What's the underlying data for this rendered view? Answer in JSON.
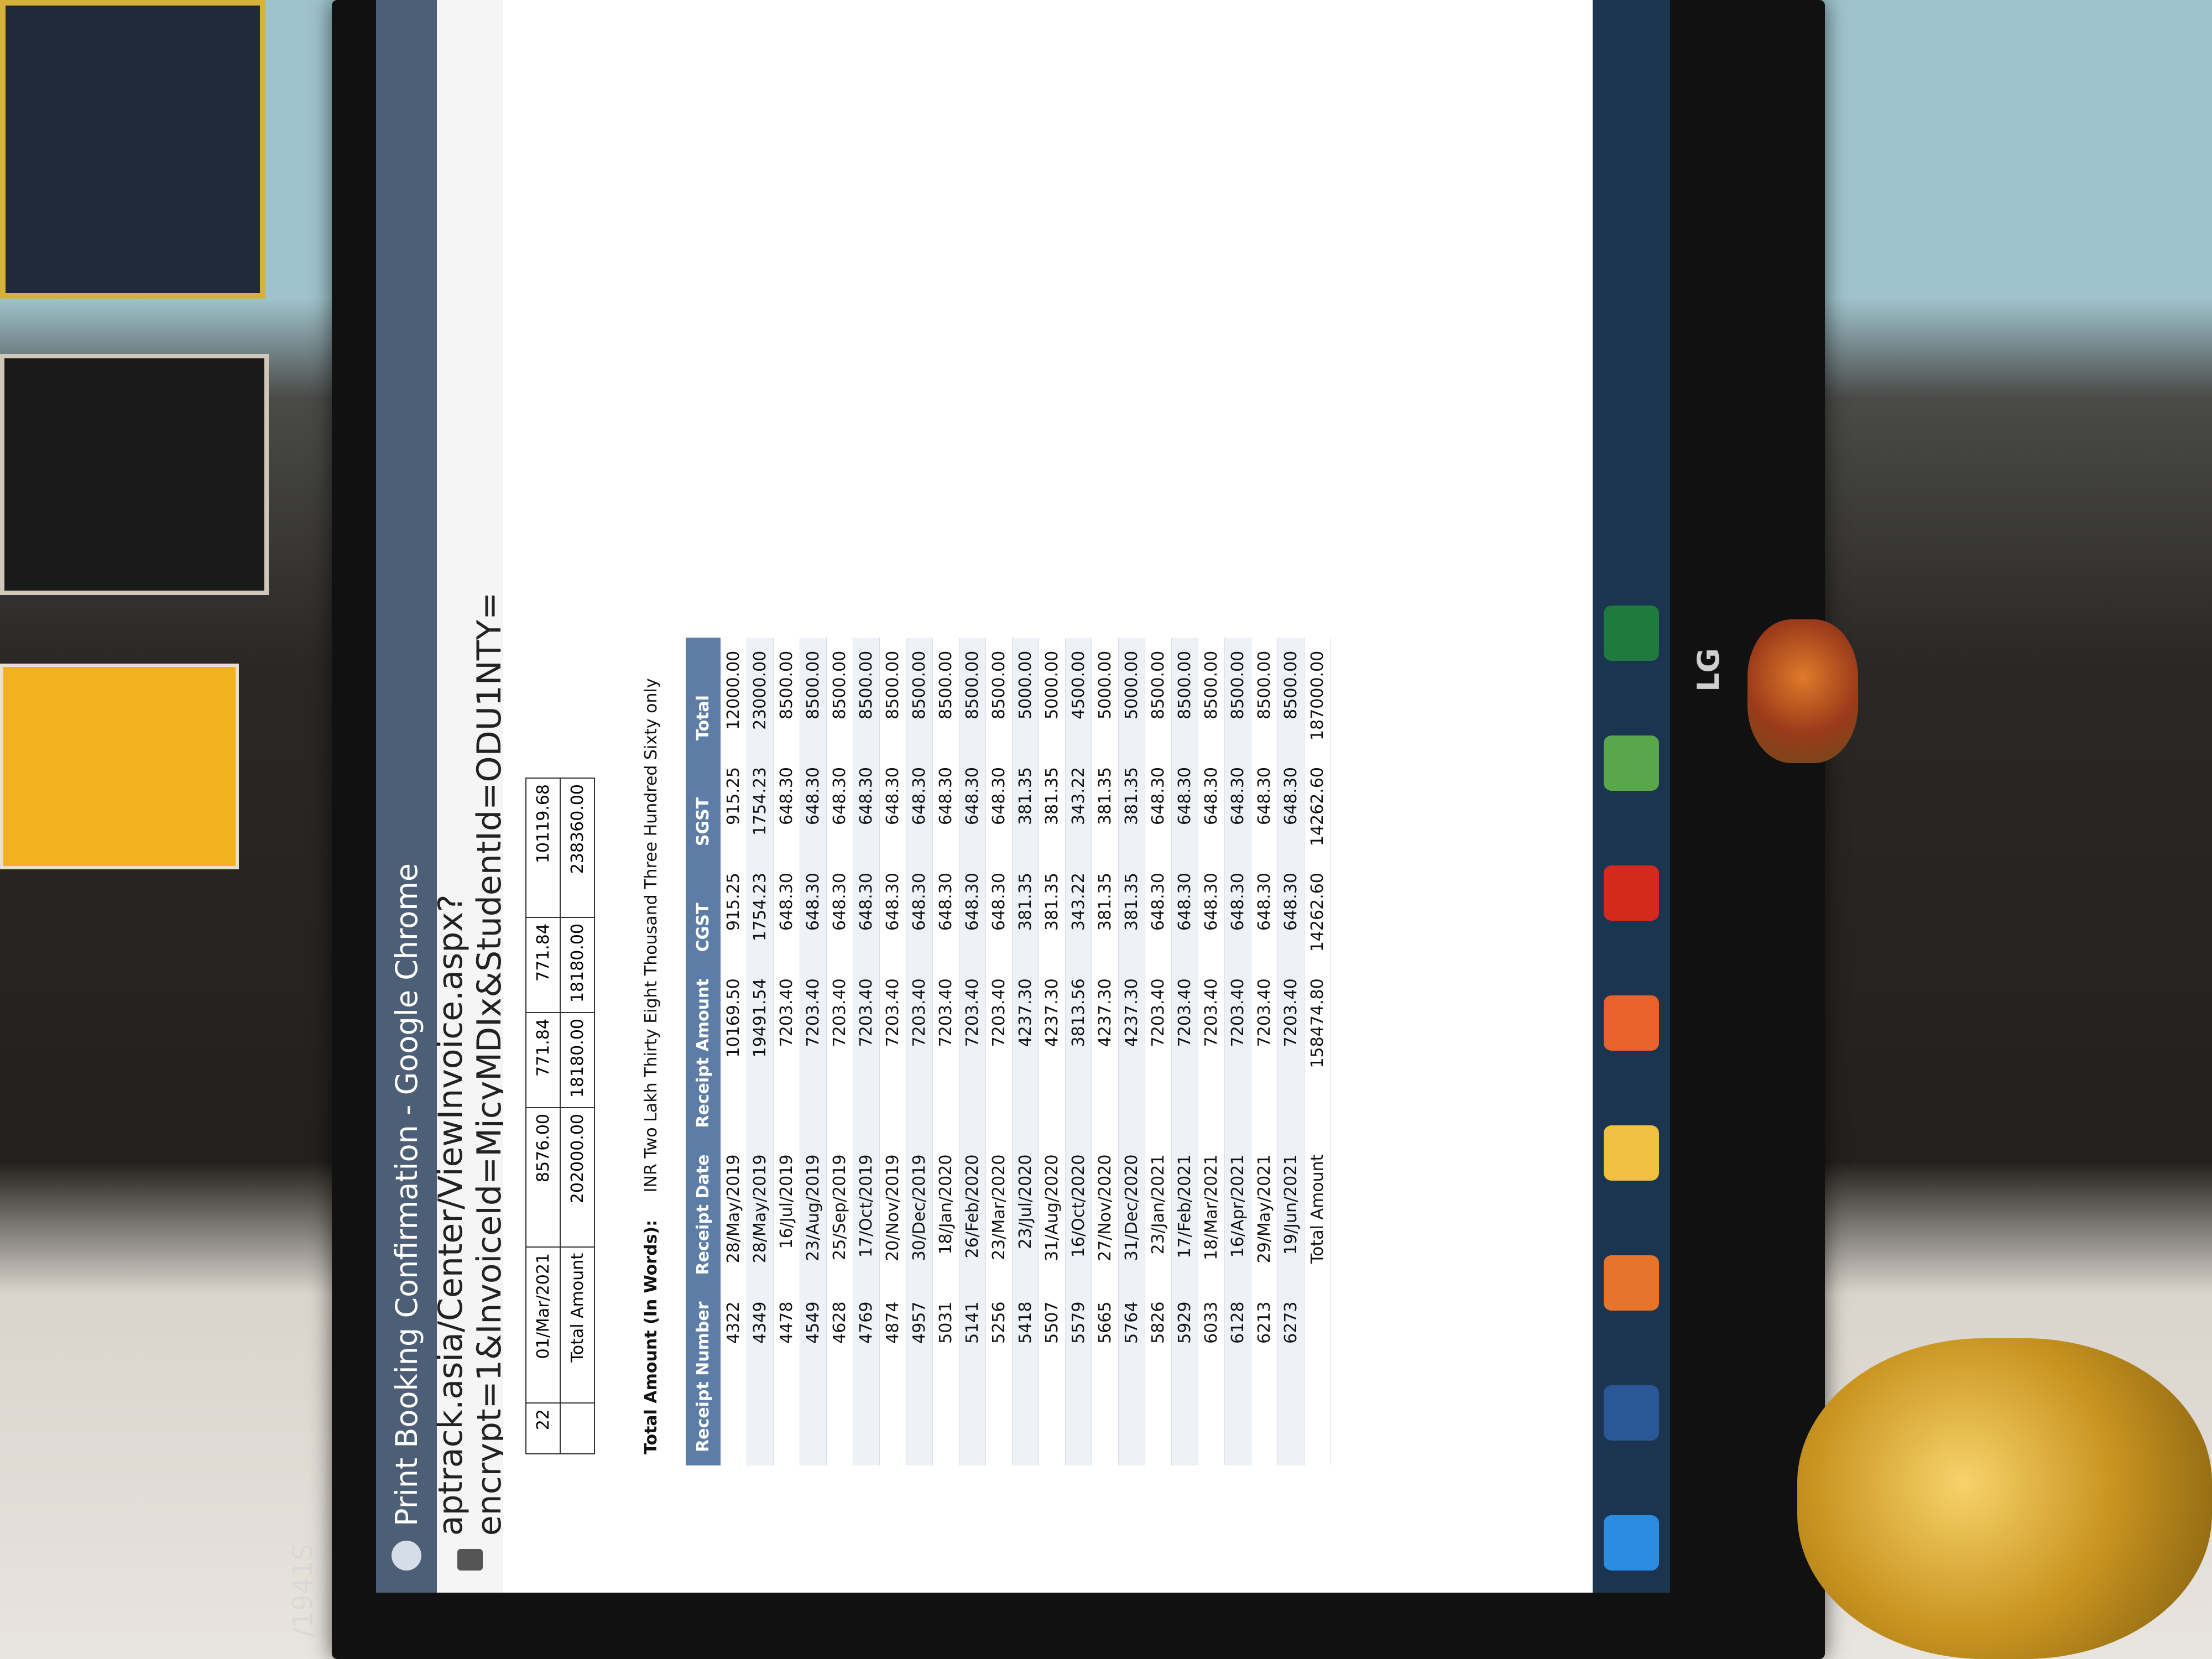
{
  "overlay_text": "/1941S",
  "monitor_brand": "LG",
  "browser": {
    "title": "Print Booking Confirmation - Google Chrome",
    "url": "aptrack.asia/Center/ViewInvoice.aspx?encrypt=1&InvoiceId=MjcyMDIx&StudentId=ODU1NTY="
  },
  "upper_table": {
    "row22": {
      "num": "22",
      "date": "01/Mar/2021",
      "amount": "8576.00",
      "cgst": "771.84",
      "sgst": "771.84",
      "total": "10119.68"
    },
    "total_row": {
      "label": "Total Amount",
      "amount": "202000.00",
      "cgst": "18180.00",
      "sgst": "18180.00",
      "total": "238360.00"
    }
  },
  "words": {
    "label": "Total Amount (In Words):",
    "value": "INR Two Lakh Thirty Eight Thousand Three Hundred Sixty only"
  },
  "receipts": {
    "headers": [
      "Receipt Number",
      "Receipt Date",
      "Receipt Amount",
      "CGST",
      "SGST",
      "Total"
    ],
    "rows": [
      [
        "4322",
        "28/May/2019",
        "10169.50",
        "915.25",
        "915.25",
        "12000.00"
      ],
      [
        "4349",
        "28/May/2019",
        "19491.54",
        "1754.23",
        "1754.23",
        "23000.00"
      ],
      [
        "4478",
        "16/Jul/2019",
        "7203.40",
        "648.30",
        "648.30",
        "8500.00"
      ],
      [
        "4549",
        "23/Aug/2019",
        "7203.40",
        "648.30",
        "648.30",
        "8500.00"
      ],
      [
        "4628",
        "25/Sep/2019",
        "7203.40",
        "648.30",
        "648.30",
        "8500.00"
      ],
      [
        "4769",
        "17/Oct/2019",
        "7203.40",
        "648.30",
        "648.30",
        "8500.00"
      ],
      [
        "4874",
        "20/Nov/2019",
        "7203.40",
        "648.30",
        "648.30",
        "8500.00"
      ],
      [
        "4957",
        "30/Dec/2019",
        "7203.40",
        "648.30",
        "648.30",
        "8500.00"
      ],
      [
        "5031",
        "18/Jan/2020",
        "7203.40",
        "648.30",
        "648.30",
        "8500.00"
      ],
      [
        "5141",
        "26/Feb/2020",
        "7203.40",
        "648.30",
        "648.30",
        "8500.00"
      ],
      [
        "5256",
        "23/Mar/2020",
        "7203.40",
        "648.30",
        "648.30",
        "8500.00"
      ],
      [
        "5418",
        "23/Jul/2020",
        "4237.30",
        "381.35",
        "381.35",
        "5000.00"
      ],
      [
        "5507",
        "31/Aug/2020",
        "4237.30",
        "381.35",
        "381.35",
        "5000.00"
      ],
      [
        "5579",
        "16/Oct/2020",
        "3813.56",
        "343.22",
        "343.22",
        "4500.00"
      ],
      [
        "5665",
        "27/Nov/2020",
        "4237.30",
        "381.35",
        "381.35",
        "5000.00"
      ],
      [
        "5764",
        "31/Dec/2020",
        "4237.30",
        "381.35",
        "381.35",
        "5000.00"
      ],
      [
        "5826",
        "23/Jan/2021",
        "7203.40",
        "648.30",
        "648.30",
        "8500.00"
      ],
      [
        "5929",
        "17/Feb/2021",
        "7203.40",
        "648.30",
        "648.30",
        "8500.00"
      ],
      [
        "6033",
        "18/Mar/2021",
        "7203.40",
        "648.30",
        "648.30",
        "8500.00"
      ],
      [
        "6128",
        "16/Apr/2021",
        "7203.40",
        "648.30",
        "648.30",
        "8500.00"
      ],
      [
        "6213",
        "29/May/2021",
        "7203.40",
        "648.30",
        "648.30",
        "8500.00"
      ],
      [
        "6273",
        "19/Jun/2021",
        "7203.40",
        "648.30",
        "648.30",
        "8500.00"
      ]
    ],
    "total": {
      "label": "Total Amount",
      "amount": "158474.80",
      "cgst": "14262.60",
      "sgst": "14262.60",
      "total": "187000.00"
    }
  },
  "taskbar_icons": [
    "ie-icon",
    "word-icon",
    "media-player-icon",
    "folder-icon",
    "firefox-icon",
    "acrobat-icon",
    "chrome-icon",
    "excel-icon"
  ],
  "colors": {
    "header_bg": "#5c7ea6",
    "titlebar": "#4d5f76",
    "taskbar": "#1b3550"
  }
}
